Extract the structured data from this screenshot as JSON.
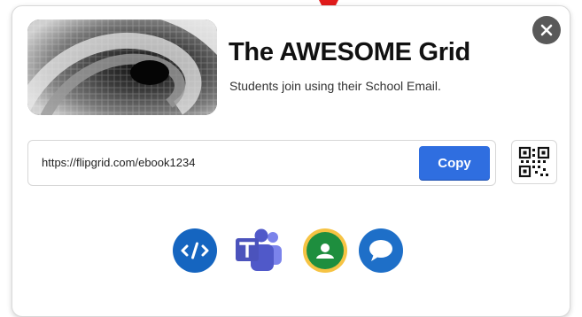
{
  "dialog": {
    "title": "The AWESOME Grid",
    "subtitle": "Students join using their School Email.",
    "cover_image_alt": "spiral staircase"
  },
  "link": {
    "url": "https://flipgrid.com/ebook1234",
    "copy_label": "Copy"
  },
  "icons": {
    "close": "close-icon",
    "qr": "qr-code-icon",
    "share": [
      "embed-code-icon",
      "microsoft-teams-icon",
      "google-classroom-icon",
      "chat-bubble-icon"
    ]
  },
  "colors": {
    "accent": "#2f6ee0",
    "pointer": "#e11b1b",
    "embed": "#1565c0",
    "teams": "#5059c9",
    "classroom": "#1e8e3e",
    "chat": "#1e6fc8"
  }
}
